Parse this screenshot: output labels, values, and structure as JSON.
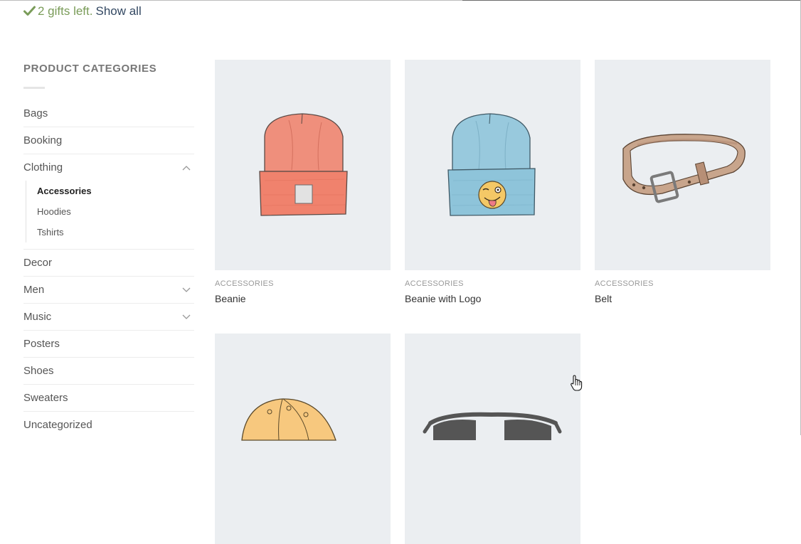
{
  "notice": {
    "icon": "checkmark-icon",
    "text": "2 gifts left.",
    "link": "Show all"
  },
  "sidebar": {
    "title": "PRODUCT CATEGORIES",
    "categories": [
      {
        "label": "Bags"
      },
      {
        "label": "Booking"
      },
      {
        "label": "Clothing",
        "expanded": true,
        "children": [
          {
            "label": "Accessories",
            "active": true
          },
          {
            "label": "Hoodies"
          },
          {
            "label": "Tshirts"
          }
        ]
      },
      {
        "label": "Decor"
      },
      {
        "label": "Men",
        "expandable": true
      },
      {
        "label": "Music",
        "expandable": true
      },
      {
        "label": "Posters"
      },
      {
        "label": "Shoes"
      },
      {
        "label": "Sweaters"
      },
      {
        "label": "Uncategorized"
      }
    ]
  },
  "products": [
    {
      "category": "ACCESSORIES",
      "name": "Beanie",
      "image": "red-beanie"
    },
    {
      "category": "ACCESSORIES",
      "name": "Beanie with Logo",
      "image": "blue-beanie-with-emoji"
    },
    {
      "category": "ACCESSORIES",
      "name": "Belt",
      "image": "leather-belt"
    },
    {
      "category": "",
      "name": "",
      "image": "yellow-cap"
    },
    {
      "category": "",
      "name": "",
      "image": "sunglasses"
    }
  ],
  "colors": {
    "notice_text": "#7a9c59",
    "link": "#334862",
    "thumb_bg": "#ebeef1"
  }
}
